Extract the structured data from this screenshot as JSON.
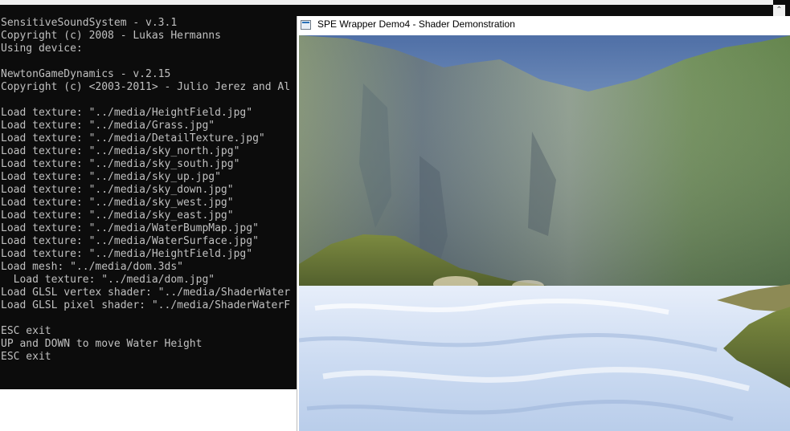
{
  "console": {
    "lines": [
      "SensitiveSoundSystem - v.3.1",
      "Copyright (c) 2008 - Lukas Hermanns",
      "Using device:",
      "",
      "NewtonGameDynamics - v.2.15",
      "Copyright (c) <2003-2011> - Julio Jerez and Al",
      "",
      "Load texture: \"../media/HeightField.jpg\"",
      "Load texture: \"../media/Grass.jpg\"",
      "Load texture: \"../media/DetailTexture.jpg\"",
      "Load texture: \"../media/sky_north.jpg\"",
      "Load texture: \"../media/sky_south.jpg\"",
      "Load texture: \"../media/sky_up.jpg\"",
      "Load texture: \"../media/sky_down.jpg\"",
      "Load texture: \"../media/sky_west.jpg\"",
      "Load texture: \"../media/sky_east.jpg\"",
      "Load texture: \"../media/WaterBumpMap.jpg\"",
      "Load texture: \"../media/WaterSurface.jpg\"",
      "Load texture: \"../media/HeightField.jpg\"",
      "Load mesh: \"../media/dom.3ds\"",
      "  Load texture: \"../media/dom.jpg\"",
      "Load GLSL vertex shader: \"../media/ShaderWater",
      "Load GLSL pixel shader: \"../media/ShaderWaterF",
      "",
      "ESC exit",
      "UP and DOWN to move Water Height",
      "ESC exit"
    ],
    "scroll_up_glyph": "⌃"
  },
  "render_window": {
    "title": "SPE Wrapper Demo4 - Shader Demonstration"
  },
  "colors": {
    "console_bg": "#0c0c0c",
    "console_text": "#c0c0c0",
    "sky": "#5a7aac",
    "cliff": "#6f8089",
    "grass": "#6f7d3d",
    "water": "#d9e6f7"
  }
}
